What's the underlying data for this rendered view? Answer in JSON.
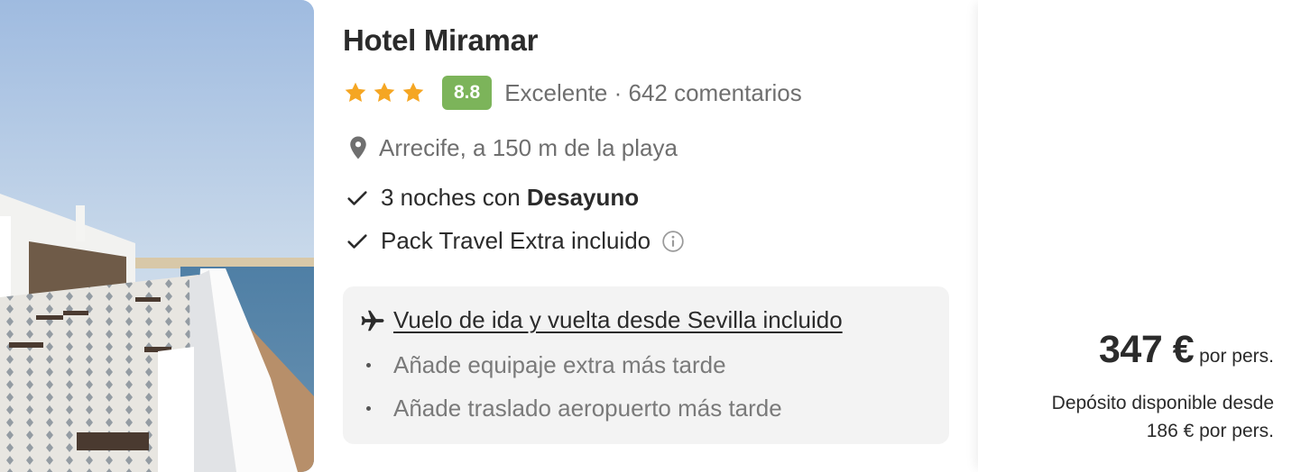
{
  "hotel": {
    "name": "Hotel Miramar",
    "stars": 3,
    "score": "8.8",
    "rating_text": "Excelente · 642 comentarios",
    "location": "Arrecife, a 150 m de la playa"
  },
  "features": {
    "nights_prefix": "3 noches con ",
    "nights_bold": "Desayuno",
    "pack": "Pack Travel Extra incluido"
  },
  "flight": {
    "link_text": "Vuelo de ida y vuelta desde Sevilla incluido",
    "extras": [
      "Añade equipaje extra más tarde",
      "Añade traslado aeropuerto más tarde"
    ]
  },
  "price": {
    "amount": "347 €",
    "unit": "por pers.",
    "deposit_line1": "Depósito disponible desde",
    "deposit_line2": "186 € por pers."
  },
  "colors": {
    "star": "#f5a623",
    "score_badge": "#7cb45a",
    "flight_box": "#f3f3f3"
  },
  "icons": [
    "star-icon",
    "location-pin-icon",
    "check-icon",
    "info-icon",
    "plane-icon"
  ]
}
